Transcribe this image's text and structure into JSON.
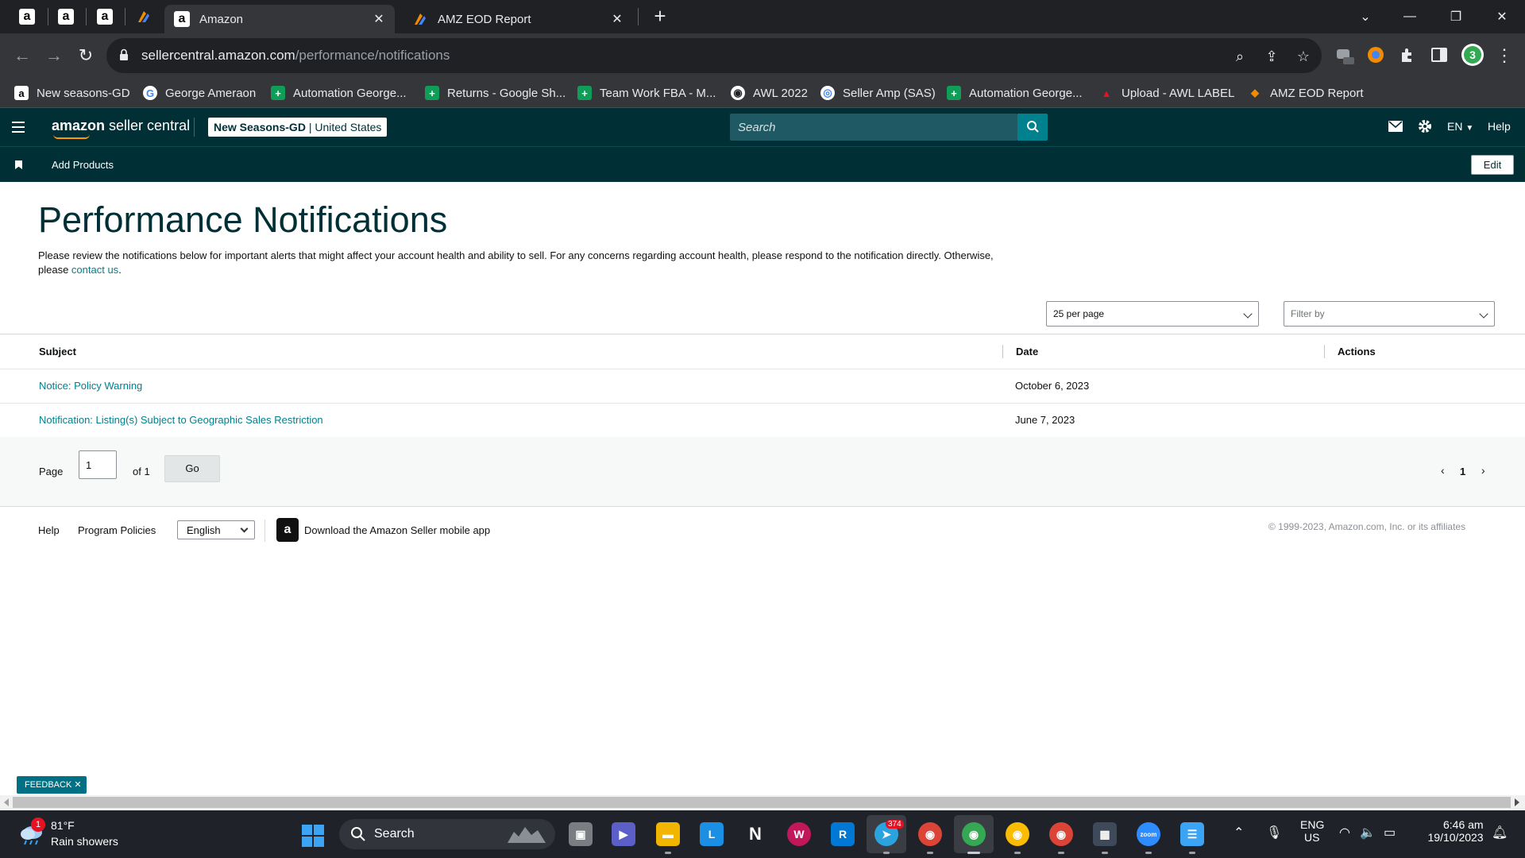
{
  "browser": {
    "tabs": [
      {
        "title": "Amazon"
      },
      {
        "title": "AMZ EOD Report"
      }
    ],
    "url_domain": "sellercentral.amazon.com",
    "url_path": "/performance/notifications",
    "bookmarks": [
      {
        "label": "New seasons-GD",
        "icon": "a",
        "color": "#ffffff"
      },
      {
        "label": "George Ameraon",
        "icon": "G",
        "color": "#ffffff"
      },
      {
        "label": "Automation George...",
        "icon": "+",
        "color": "#0f9d58"
      },
      {
        "label": "Returns - Google Sh...",
        "icon": "+",
        "color": "#0f9d58"
      },
      {
        "label": "Team Work FBA - M...",
        "icon": "+",
        "color": "#0f9d58"
      },
      {
        "label": "AWL 2022",
        "icon": "◉",
        "color": "#ffffff"
      },
      {
        "label": "Seller Amp (SAS)",
        "icon": "◎",
        "color": "#ffffff"
      },
      {
        "label": "Automation George...",
        "icon": "+",
        "color": "#0f9d58"
      },
      {
        "label": "Upload - AWL LABEL",
        "icon": "▲",
        "color": "#e81123"
      },
      {
        "label": "AMZ EOD Report",
        "icon": "◆",
        "color": "#f28b00"
      }
    ]
  },
  "header": {
    "logo_bold": "amazon",
    "logo_rest": " seller central",
    "store_name": "New Seasons-GD",
    "store_region": " | United States",
    "search_placeholder": "Search",
    "lang": "EN",
    "help": "Help",
    "add_products": "Add Products",
    "edit": "Edit"
  },
  "page": {
    "title": "Performance Notifications",
    "desc_line1": "Please review the notifications below for important alerts that might affect your account health and ability to sell. For any concerns regarding account health, please respond to the notification directly. Otherwise,",
    "desc_please": "please ",
    "desc_link": "contact us",
    "desc_end": ".",
    "per_page": "25 per page",
    "filter_placeholder": "Filter by"
  },
  "table": {
    "columns": {
      "subject": "Subject",
      "date": "Date",
      "actions": "Actions"
    },
    "rows": [
      {
        "subject": "Notice: Policy Warning",
        "date": "October 6, 2023"
      },
      {
        "subject": "Notification: Listing(s) Subject to Geographic Sales Restriction",
        "date": "June 7, 2023"
      }
    ]
  },
  "pager": {
    "page_label": "Page",
    "page_value": "1",
    "of_label": "of 1",
    "go": "Go",
    "current": "1"
  },
  "footer": {
    "help": "Help",
    "policies": "Program Policies",
    "language": "English",
    "download": "Download the Amazon Seller mobile app",
    "copyright": "© 1999-2023, Amazon.com, Inc. or its affiliates"
  },
  "feedback": "FEEDBACK",
  "taskbar": {
    "weather_badge": "1",
    "temperature": "81°F",
    "condition": "Rain showers",
    "search": "Search",
    "telegram_badge": "374",
    "lang_top": "ENG",
    "lang_bottom": "US",
    "time": "6:46 am",
    "date": "19/10/2023"
  },
  "colors": {
    "header_bg": "#002f36",
    "link": "#00818d",
    "search_btn": "#00818d"
  }
}
